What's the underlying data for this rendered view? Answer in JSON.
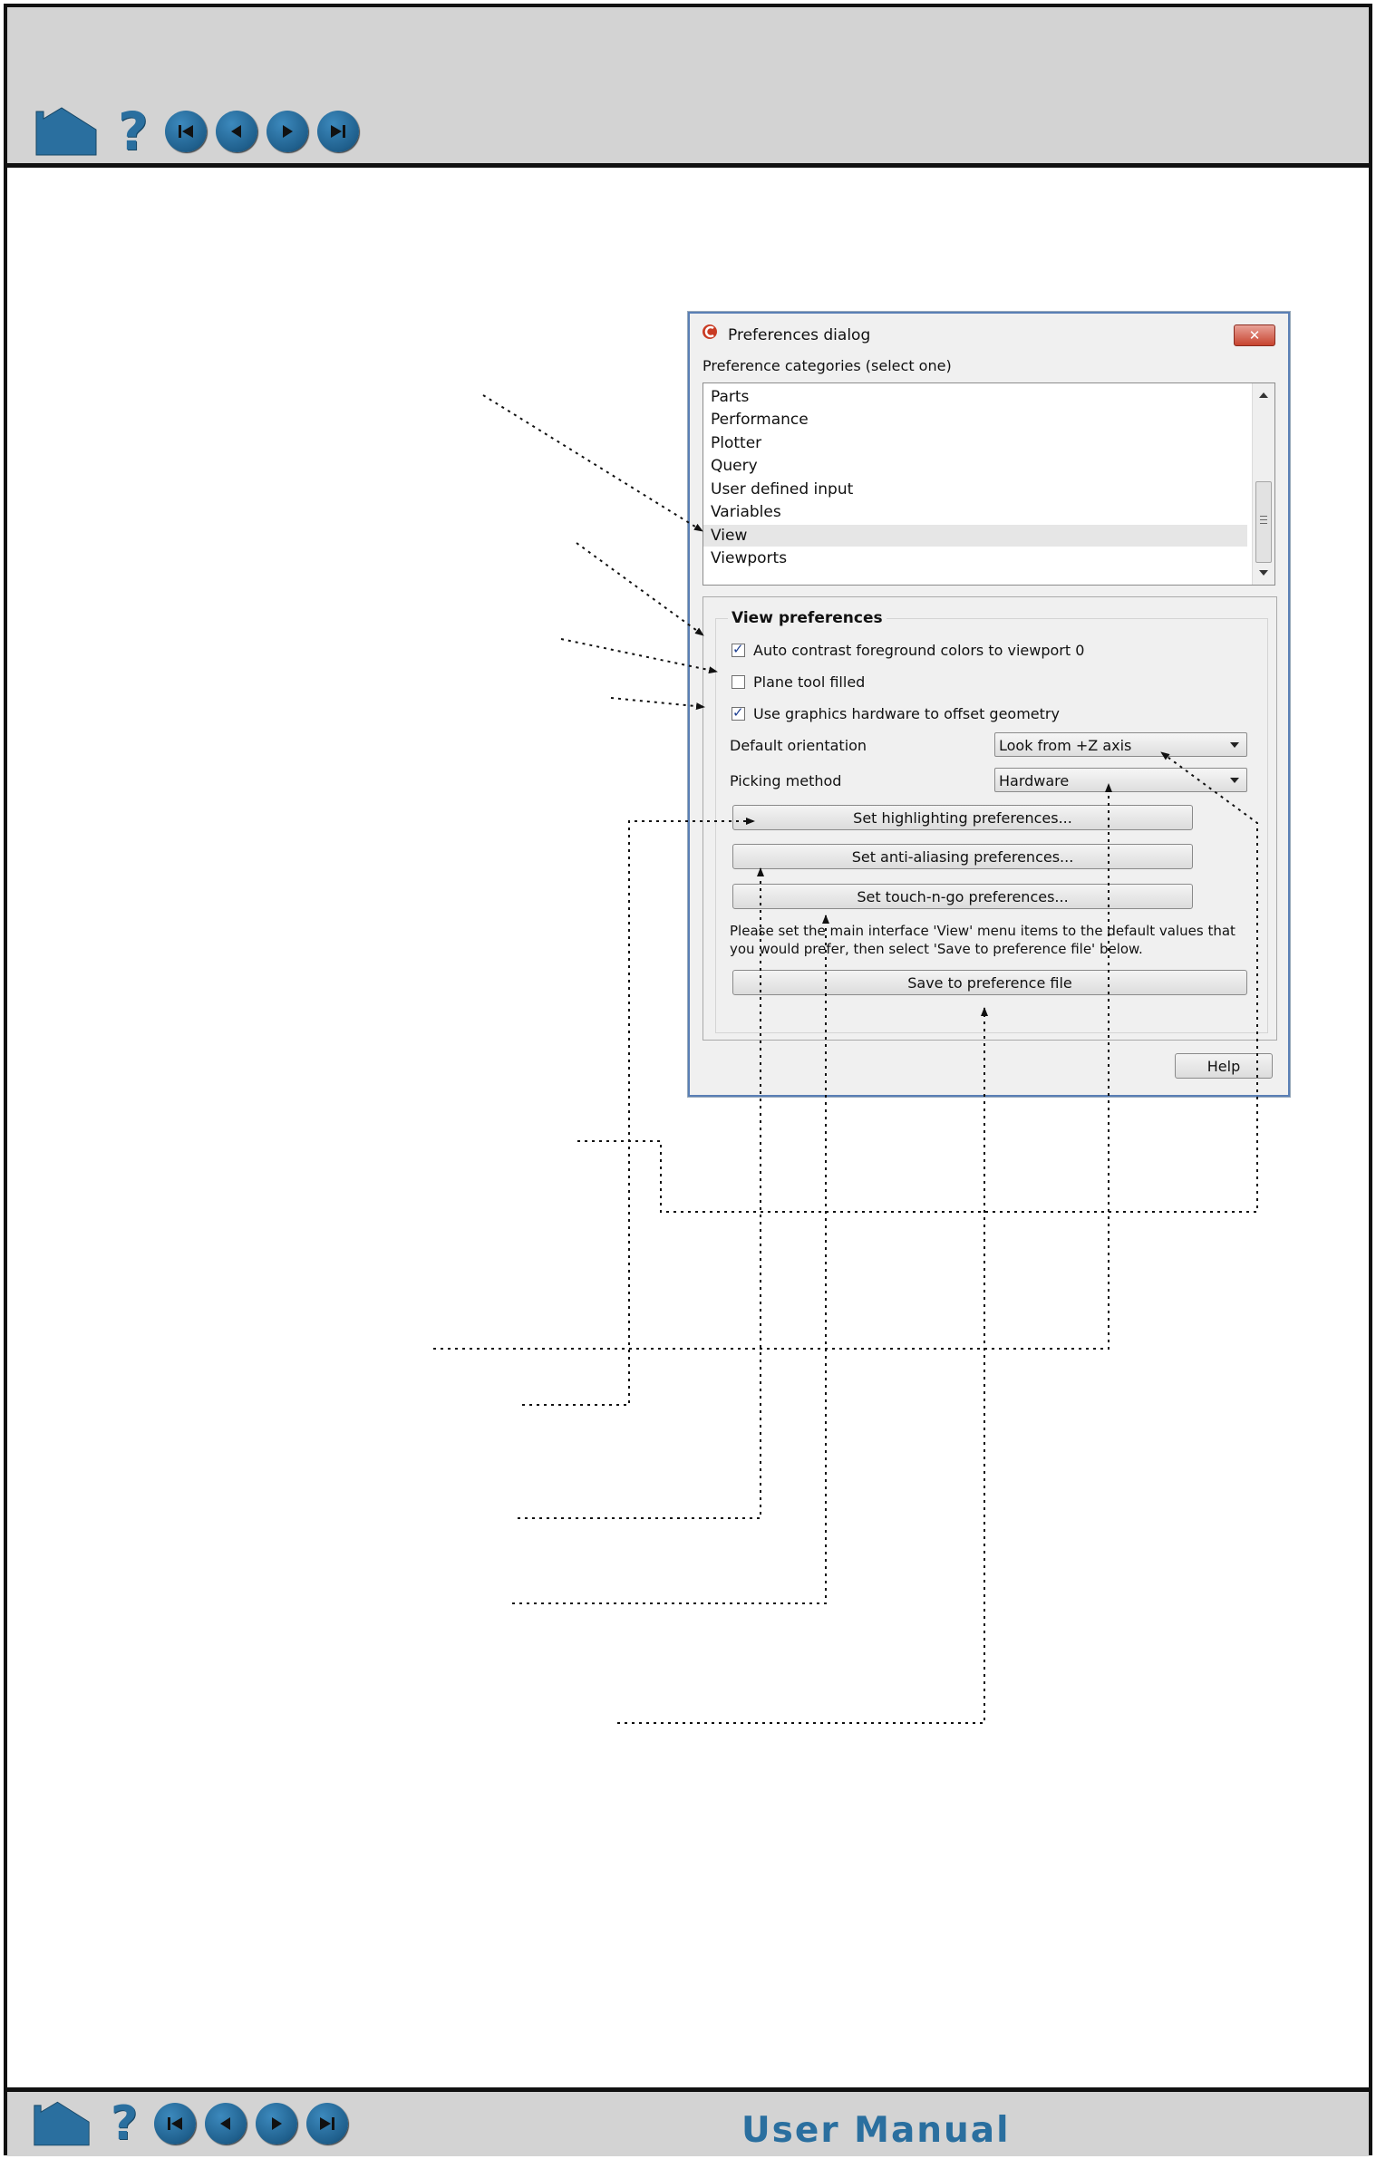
{
  "header": {
    "nav_icons": [
      "home-icon",
      "help-icon",
      "first-page-icon",
      "previous-page-icon",
      "next-page-icon",
      "last-page-icon"
    ]
  },
  "footer": {
    "title": "User Manual",
    "nav_icons": [
      "home-icon",
      "help-icon",
      "first-page-icon",
      "previous-page-icon",
      "next-page-icon",
      "last-page-icon"
    ]
  },
  "dialog": {
    "title": "Preferences dialog",
    "close_glyph": "✕",
    "categories_label": "Preference categories (select one)",
    "categories": [
      "Parts",
      "Performance",
      "Plotter",
      "Query",
      "User defined input",
      "Variables",
      "View",
      "Viewports"
    ],
    "selected_category": "View",
    "group_title": "View preferences",
    "checkboxes": [
      {
        "label": "Auto contrast foreground colors to viewport 0",
        "checked": true
      },
      {
        "label": "Plane tool filled",
        "checked": false
      },
      {
        "label": "Use graphics hardware to offset geometry",
        "checked": true
      }
    ],
    "default_orientation": {
      "label": "Default orientation",
      "value": "Look from +Z axis"
    },
    "picking_method": {
      "label": "Picking method",
      "value": "Hardware"
    },
    "buttons": {
      "highlighting": "Set highlighting preferences...",
      "anti_aliasing": "Set anti-aliasing preferences...",
      "touch_n_go": "Set touch-n-go preferences...",
      "save": "Save to preference file",
      "help": "Help"
    },
    "note": "Please set the main interface 'View' menu items to the default values that you would prefer, then select 'Save to preference file' below."
  },
  "colors": {
    "brand_blue": "#2a6f9f",
    "bar_gray": "#d3d3d3"
  }
}
